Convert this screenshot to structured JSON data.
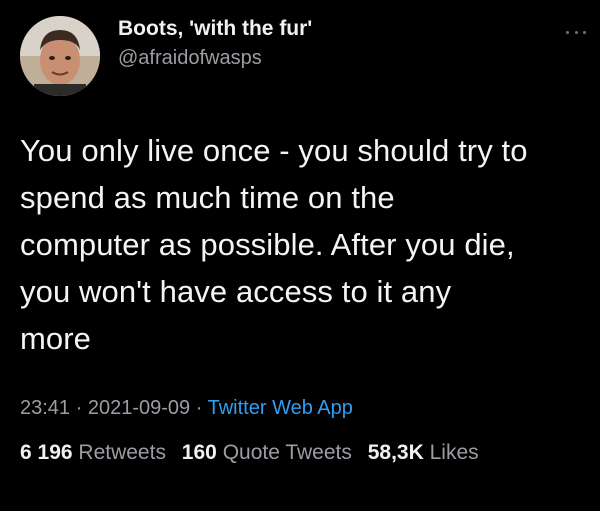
{
  "tweet": {
    "display_name": "Boots, 'with the fur'",
    "handle": "@afraidofwasps",
    "text_lines": [
      "You only live once - you should try to",
      "spend as much time on the",
      "computer as possible. After you die,",
      "you won't have access to it any",
      "more"
    ],
    "time": "23:41",
    "date": "2021-09-09",
    "separator": "·",
    "source": "Twitter Web App",
    "stats": {
      "retweets_count": "6 196",
      "retweets_label": "Retweets",
      "quote_count": "160",
      "quote_label": "Quote Tweets",
      "likes_count": "58,3K",
      "likes_label": "Likes"
    },
    "icons": {
      "more": "more-options-icon",
      "avatar": "profile-avatar"
    },
    "colors": {
      "background": "#000000",
      "text": "#f4f4f4",
      "secondary": "#9a9ea3",
      "link": "#2f9ef0"
    }
  }
}
